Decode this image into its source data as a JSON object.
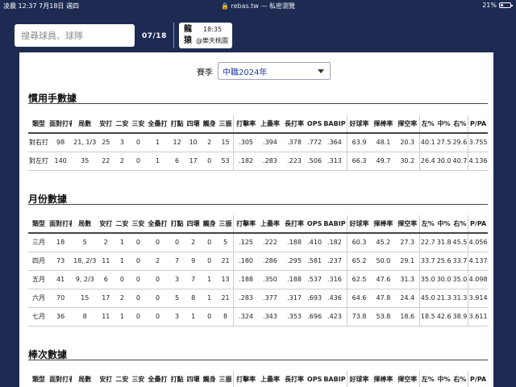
{
  "status_bar": {
    "time_date": "凌晨 12:37   7月18日 週四",
    "url": "🔒 rebas.tw — 私密瀏覽",
    "battery": "21%",
    "battery_level": 0.21
  },
  "header": {
    "search_placeholder": "搜尋球員、球隊",
    "pager": "07/18",
    "game": {
      "team": "龍 猿",
      "time": "18:35",
      "venue": "@樂天桃園"
    }
  },
  "season": {
    "label": "賽季",
    "selected": "中職2024年"
  },
  "columns": [
    "類型",
    "面對打者",
    "局數",
    "安打",
    "二安",
    "三安",
    "全壘打",
    "打點",
    "四壞",
    "觸身",
    "三振",
    "打擊率",
    "上壘率",
    "長打率",
    "OPS",
    "BABIP",
    "好球率",
    "揮棒率",
    "揮空率",
    "左%",
    "中%",
    "右%",
    "P/PA"
  ],
  "sections": {
    "handedness": {
      "title": "慣用手數據",
      "rows": [
        [
          "對右打",
          "98",
          "21, 1/3",
          "25",
          "3",
          "0",
          "1",
          "12",
          "10",
          "2",
          "15",
          ".305",
          ".394",
          ".378",
          ".772",
          ".364",
          "63.9",
          "48.1",
          "20.3",
          "40.1",
          "27.5",
          "29.6",
          "3.755"
        ],
        [
          "對左打",
          "140",
          "35",
          "22",
          "2",
          "0",
          "1",
          "6",
          "17",
          "0",
          "53",
          ".182",
          ".283",
          ".223",
          ".506",
          ".313",
          "66.3",
          "49.7",
          "30.2",
          "26.4",
          "30.0",
          "40.7",
          "4.136"
        ]
      ]
    },
    "monthly": {
      "title": "月份數據",
      "rows": [
        [
          "三月",
          "18",
          "5",
          "2",
          "1",
          "0",
          "0",
          "0",
          "2",
          "0",
          "5",
          ".125",
          ".222",
          ".188",
          ".410",
          ".182",
          "60.3",
          "45.2",
          "27.3",
          "22.7",
          "31.8",
          "45.5",
          "4.056"
        ],
        [
          "四月",
          "73",
          "18, 2/3",
          "11",
          "1",
          "0",
          "2",
          "7",
          "9",
          "0",
          "21",
          ".180",
          ".286",
          ".295",
          ".581",
          ".237",
          "65.2",
          "50.0",
          "29.1",
          "33.7",
          "25.6",
          "33.7",
          "4.137"
        ],
        [
          "五月",
          "41",
          "9, 2/3",
          "6",
          "0",
          "0",
          "0",
          "3",
          "7",
          "1",
          "13",
          ".188",
          ".350",
          ".188",
          ".537",
          ".316",
          "62.5",
          "47.6",
          "31.3",
          "35.0",
          "30.0",
          "35.0",
          "4.098"
        ],
        [
          "六月",
          "70",
          "15",
          "17",
          "2",
          "0",
          "0",
          "5",
          "8",
          "1",
          "21",
          ".283",
          ".377",
          ".317",
          ".693",
          ".436",
          "64.6",
          "47.8",
          "24.4",
          "45.0",
          "21.3",
          "31.3",
          "3.914"
        ],
        [
          "七月",
          "36",
          "8",
          "11",
          "1",
          "0",
          "0",
          "3",
          "1",
          "0",
          "8",
          ".324",
          ".343",
          ".353",
          ".696",
          ".423",
          "73.8",
          "53.8",
          "18.6",
          "18.5",
          "42.6",
          "38.9",
          "3.611"
        ]
      ]
    },
    "batting_order": {
      "title": "棒次數據",
      "rows": []
    }
  }
}
